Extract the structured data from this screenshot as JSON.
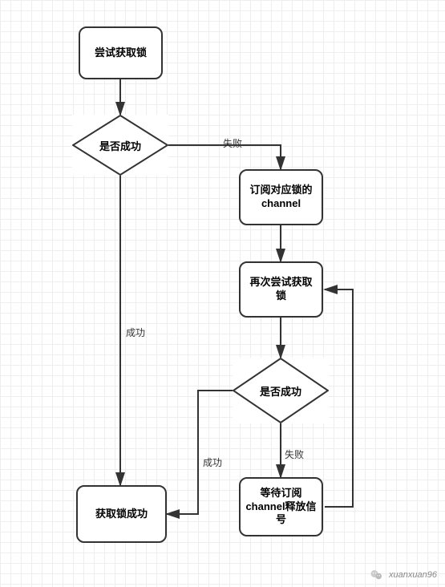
{
  "chart_data": {
    "type": "flowchart",
    "nodes": [
      {
        "id": "n1",
        "shape": "process",
        "label": "尝试获取锁"
      },
      {
        "id": "n2",
        "shape": "decision",
        "label": "是否成功"
      },
      {
        "id": "n3",
        "shape": "process",
        "label": "订阅对应锁的\nchannel"
      },
      {
        "id": "n4",
        "shape": "process",
        "label": "再次尝试获取\n锁"
      },
      {
        "id": "n5",
        "shape": "decision",
        "label": "是否成功"
      },
      {
        "id": "n6",
        "shape": "process",
        "label": "等待订阅\nchannel释放\n信号"
      },
      {
        "id": "n7",
        "shape": "process",
        "label": "获取锁成功"
      }
    ],
    "edges": [
      {
        "from": "n1",
        "to": "n2",
        "label": ""
      },
      {
        "from": "n2",
        "to": "n3",
        "label": "失败"
      },
      {
        "from": "n2",
        "to": "n7",
        "label": "成功"
      },
      {
        "from": "n3",
        "to": "n4",
        "label": ""
      },
      {
        "from": "n4",
        "to": "n5",
        "label": ""
      },
      {
        "from": "n5",
        "to": "n6",
        "label": "失败"
      },
      {
        "from": "n5",
        "to": "n7",
        "label": "成功"
      },
      {
        "from": "n6",
        "to": "n4",
        "label": ""
      }
    ]
  },
  "nodes": {
    "n1": "尝试获取锁",
    "n2": "是否成功",
    "n3": "订阅对应锁的channel",
    "n4": "再次尝试获取锁",
    "n5": "是否成功",
    "n6": "等待订阅channel释放信号",
    "n7": "获取锁成功"
  },
  "labels": {
    "fail1": "失败",
    "success1": "成功",
    "fail2": "失败",
    "success2": "成功"
  },
  "footer": {
    "handle": "xuanxuan96"
  }
}
